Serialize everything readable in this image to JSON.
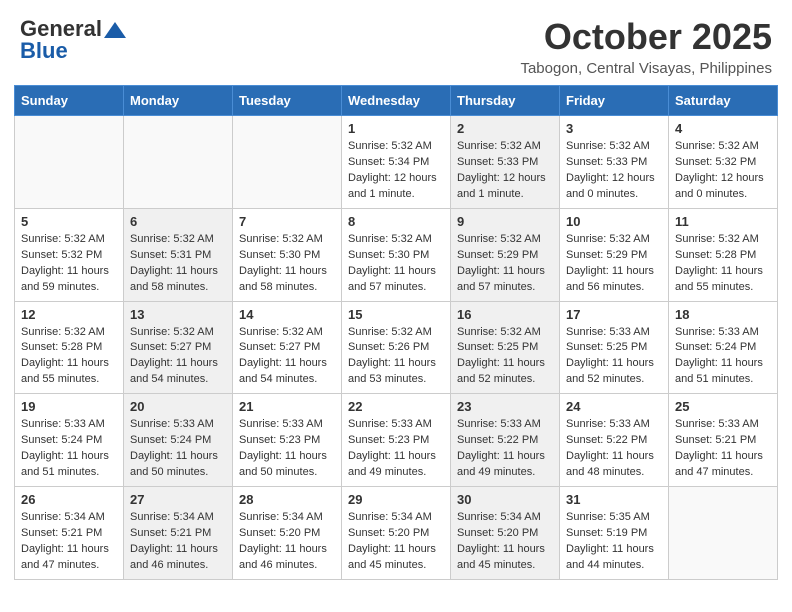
{
  "header": {
    "logo_line1": "General",
    "logo_line2": "Blue",
    "month": "October 2025",
    "location": "Tabogon, Central Visayas, Philippines"
  },
  "weekdays": [
    "Sunday",
    "Monday",
    "Tuesday",
    "Wednesday",
    "Thursday",
    "Friday",
    "Saturday"
  ],
  "weeks": [
    [
      {
        "day": "",
        "info": "",
        "shaded": false,
        "empty": true
      },
      {
        "day": "",
        "info": "",
        "shaded": false,
        "empty": true
      },
      {
        "day": "",
        "info": "",
        "shaded": false,
        "empty": true
      },
      {
        "day": "1",
        "info": "Sunrise: 5:32 AM\nSunset: 5:34 PM\nDaylight: 12 hours\nand 1 minute.",
        "shaded": false,
        "empty": false
      },
      {
        "day": "2",
        "info": "Sunrise: 5:32 AM\nSunset: 5:33 PM\nDaylight: 12 hours\nand 1 minute.",
        "shaded": true,
        "empty": false
      },
      {
        "day": "3",
        "info": "Sunrise: 5:32 AM\nSunset: 5:33 PM\nDaylight: 12 hours\nand 0 minutes.",
        "shaded": false,
        "empty": false
      },
      {
        "day": "4",
        "info": "Sunrise: 5:32 AM\nSunset: 5:32 PM\nDaylight: 12 hours\nand 0 minutes.",
        "shaded": false,
        "empty": false
      }
    ],
    [
      {
        "day": "5",
        "info": "Sunrise: 5:32 AM\nSunset: 5:32 PM\nDaylight: 11 hours\nand 59 minutes.",
        "shaded": false,
        "empty": false
      },
      {
        "day": "6",
        "info": "Sunrise: 5:32 AM\nSunset: 5:31 PM\nDaylight: 11 hours\nand 58 minutes.",
        "shaded": true,
        "empty": false
      },
      {
        "day": "7",
        "info": "Sunrise: 5:32 AM\nSunset: 5:30 PM\nDaylight: 11 hours\nand 58 minutes.",
        "shaded": false,
        "empty": false
      },
      {
        "day": "8",
        "info": "Sunrise: 5:32 AM\nSunset: 5:30 PM\nDaylight: 11 hours\nand 57 minutes.",
        "shaded": false,
        "empty": false
      },
      {
        "day": "9",
        "info": "Sunrise: 5:32 AM\nSunset: 5:29 PM\nDaylight: 11 hours\nand 57 minutes.",
        "shaded": true,
        "empty": false
      },
      {
        "day": "10",
        "info": "Sunrise: 5:32 AM\nSunset: 5:29 PM\nDaylight: 11 hours\nand 56 minutes.",
        "shaded": false,
        "empty": false
      },
      {
        "day": "11",
        "info": "Sunrise: 5:32 AM\nSunset: 5:28 PM\nDaylight: 11 hours\nand 55 minutes.",
        "shaded": false,
        "empty": false
      }
    ],
    [
      {
        "day": "12",
        "info": "Sunrise: 5:32 AM\nSunset: 5:28 PM\nDaylight: 11 hours\nand 55 minutes.",
        "shaded": false,
        "empty": false
      },
      {
        "day": "13",
        "info": "Sunrise: 5:32 AM\nSunset: 5:27 PM\nDaylight: 11 hours\nand 54 minutes.",
        "shaded": true,
        "empty": false
      },
      {
        "day": "14",
        "info": "Sunrise: 5:32 AM\nSunset: 5:27 PM\nDaylight: 11 hours\nand 54 minutes.",
        "shaded": false,
        "empty": false
      },
      {
        "day": "15",
        "info": "Sunrise: 5:32 AM\nSunset: 5:26 PM\nDaylight: 11 hours\nand 53 minutes.",
        "shaded": false,
        "empty": false
      },
      {
        "day": "16",
        "info": "Sunrise: 5:32 AM\nSunset: 5:25 PM\nDaylight: 11 hours\nand 52 minutes.",
        "shaded": true,
        "empty": false
      },
      {
        "day": "17",
        "info": "Sunrise: 5:33 AM\nSunset: 5:25 PM\nDaylight: 11 hours\nand 52 minutes.",
        "shaded": false,
        "empty": false
      },
      {
        "day": "18",
        "info": "Sunrise: 5:33 AM\nSunset: 5:24 PM\nDaylight: 11 hours\nand 51 minutes.",
        "shaded": false,
        "empty": false
      }
    ],
    [
      {
        "day": "19",
        "info": "Sunrise: 5:33 AM\nSunset: 5:24 PM\nDaylight: 11 hours\nand 51 minutes.",
        "shaded": false,
        "empty": false
      },
      {
        "day": "20",
        "info": "Sunrise: 5:33 AM\nSunset: 5:24 PM\nDaylight: 11 hours\nand 50 minutes.",
        "shaded": true,
        "empty": false
      },
      {
        "day": "21",
        "info": "Sunrise: 5:33 AM\nSunset: 5:23 PM\nDaylight: 11 hours\nand 50 minutes.",
        "shaded": false,
        "empty": false
      },
      {
        "day": "22",
        "info": "Sunrise: 5:33 AM\nSunset: 5:23 PM\nDaylight: 11 hours\nand 49 minutes.",
        "shaded": false,
        "empty": false
      },
      {
        "day": "23",
        "info": "Sunrise: 5:33 AM\nSunset: 5:22 PM\nDaylight: 11 hours\nand 49 minutes.",
        "shaded": true,
        "empty": false
      },
      {
        "day": "24",
        "info": "Sunrise: 5:33 AM\nSunset: 5:22 PM\nDaylight: 11 hours\nand 48 minutes.",
        "shaded": false,
        "empty": false
      },
      {
        "day": "25",
        "info": "Sunrise: 5:33 AM\nSunset: 5:21 PM\nDaylight: 11 hours\nand 47 minutes.",
        "shaded": false,
        "empty": false
      }
    ],
    [
      {
        "day": "26",
        "info": "Sunrise: 5:34 AM\nSunset: 5:21 PM\nDaylight: 11 hours\nand 47 minutes.",
        "shaded": false,
        "empty": false
      },
      {
        "day": "27",
        "info": "Sunrise: 5:34 AM\nSunset: 5:21 PM\nDaylight: 11 hours\nand 46 minutes.",
        "shaded": true,
        "empty": false
      },
      {
        "day": "28",
        "info": "Sunrise: 5:34 AM\nSunset: 5:20 PM\nDaylight: 11 hours\nand 46 minutes.",
        "shaded": false,
        "empty": false
      },
      {
        "day": "29",
        "info": "Sunrise: 5:34 AM\nSunset: 5:20 PM\nDaylight: 11 hours\nand 45 minutes.",
        "shaded": false,
        "empty": false
      },
      {
        "day": "30",
        "info": "Sunrise: 5:34 AM\nSunset: 5:20 PM\nDaylight: 11 hours\nand 45 minutes.",
        "shaded": true,
        "empty": false
      },
      {
        "day": "31",
        "info": "Sunrise: 5:35 AM\nSunset: 5:19 PM\nDaylight: 11 hours\nand 44 minutes.",
        "shaded": false,
        "empty": false
      },
      {
        "day": "",
        "info": "",
        "shaded": false,
        "empty": true
      }
    ]
  ]
}
